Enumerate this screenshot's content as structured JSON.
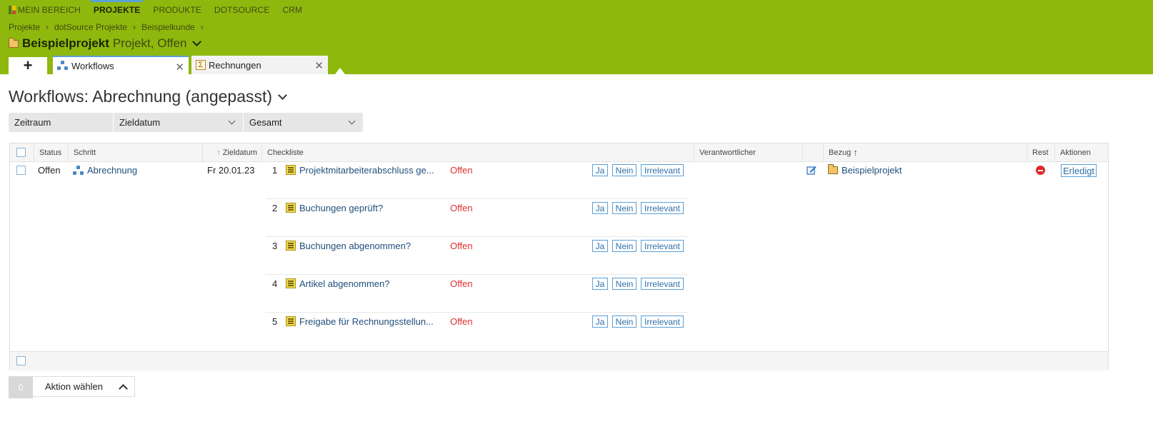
{
  "nav": {
    "items": [
      "MEIN BEREICH",
      "PROJEKTE",
      "PRODUKTE",
      "DOTSOURCE",
      "CRM"
    ],
    "active": "PROJEKTE"
  },
  "breadcrumbs": [
    "Projekte",
    "dotSource Projekte",
    "Beispielkunde"
  ],
  "project": {
    "name": "Beispielprojekt",
    "subtitle": "Projekt, Offen"
  },
  "tabs": [
    {
      "label": "Workflows",
      "active": true
    },
    {
      "label": "Rechnungen",
      "active": false
    }
  ],
  "add_tab_label": "+",
  "page_title": "Workflows: Abrechnung (angepasst)",
  "filters": [
    "Zeitraum",
    "Zieldatum",
    "Gesamt"
  ],
  "table": {
    "headers": {
      "status": "Status",
      "schritt": "Schritt",
      "zieldatum": "Zieldatum",
      "checkliste": "Checkliste",
      "verantwortlicher": "Verantwortlicher",
      "bezug": "Bezug",
      "rest": "Rest",
      "aktionen": "Aktionen"
    },
    "row": {
      "status": "Offen",
      "schritt": "Abrechnung",
      "zieldatum": "Fr 20.01.23",
      "bezug": "Beispielprojekt",
      "action": "Erledigt"
    },
    "checklist": [
      {
        "num": "1",
        "text": "Projektmitarbeiterabschluss ge...",
        "status": "Offen"
      },
      {
        "num": "2",
        "text": "Buchungen geprüft?",
        "status": "Offen"
      },
      {
        "num": "3",
        "text": "Buchungen abgenommen?",
        "status": "Offen"
      },
      {
        "num": "4",
        "text": "Artikel abgenommen?",
        "status": "Offen"
      },
      {
        "num": "5",
        "text": "Freigabe für Rechnungsstellun...",
        "status": "Offen"
      }
    ],
    "choice_buttons": [
      "Ja",
      "Nein",
      "Irrelevant"
    ]
  },
  "bottom_bar": {
    "count": "0",
    "action_label": "Aktion wählen"
  },
  "colors": {
    "topbar": "#8fb80f",
    "accent": "#5aa0d8",
    "status_open": "#e03030"
  },
  "icons": [
    "home-icon",
    "folder-icon",
    "workflow-icon",
    "sum-icon",
    "checklist-icon",
    "edit-icon",
    "stop-icon",
    "sort-up-icon"
  ]
}
